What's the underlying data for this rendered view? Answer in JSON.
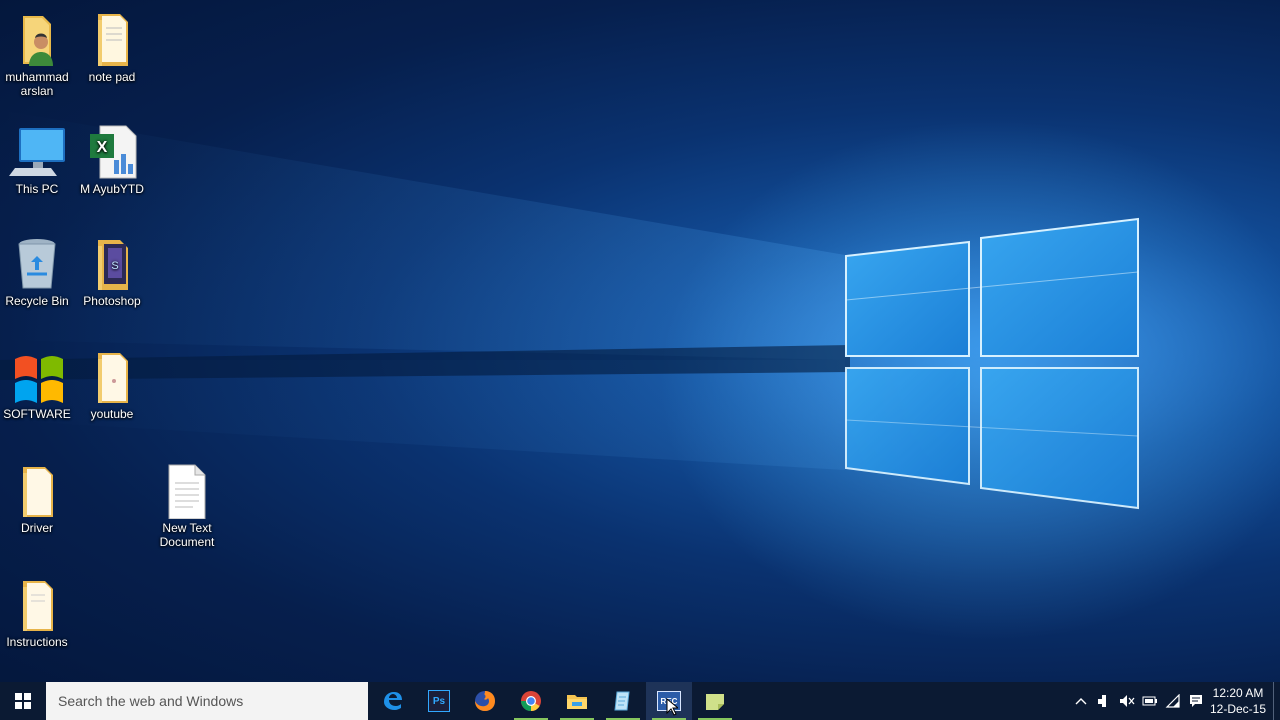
{
  "desktop": {
    "icons": [
      {
        "label": "muhammad arslan",
        "icon": "user-folder-icon"
      },
      {
        "label": "note pad",
        "icon": "folder-icon"
      },
      {
        "label": "This PC",
        "icon": "computer-icon"
      },
      {
        "label": "M AyubYTD",
        "icon": "excel-file-icon"
      },
      {
        "label": "Recycle Bin",
        "icon": "recycle-bin-icon"
      },
      {
        "label": "Photoshop",
        "icon": "folder-icon"
      },
      {
        "label": "SOFTWARE",
        "icon": "windows-logo-icon"
      },
      {
        "label": "youtube",
        "icon": "folder-icon"
      },
      {
        "label": "Driver",
        "icon": "folder-icon"
      },
      {
        "label": "New Text Document",
        "icon": "text-document-icon"
      },
      {
        "label": "Instructions",
        "icon": "folder-icon"
      }
    ]
  },
  "taskbar": {
    "search_placeholder": "Search the web and Windows",
    "apps": [
      {
        "name": "edge-app",
        "icon": "edge-icon",
        "running": false
      },
      {
        "name": "photoshop-app",
        "icon": "photoshop-icon",
        "running": false,
        "text": "Ps"
      },
      {
        "name": "firefox-app",
        "icon": "firefox-icon",
        "running": false
      },
      {
        "name": "chrome-app",
        "icon": "chrome-icon",
        "running": true
      },
      {
        "name": "file-explorer-app",
        "icon": "file-explorer-icon",
        "running": true
      },
      {
        "name": "notepad-app",
        "icon": "notepad-icon",
        "running": true
      },
      {
        "name": "recorder-app",
        "icon": "recorder-icon",
        "running": true,
        "text": "REC"
      },
      {
        "name": "sticky-notes-app",
        "icon": "sticky-notes-icon",
        "running": true
      }
    ],
    "tray": {
      "icons": [
        "chevron-up-icon",
        "network-tray-icon",
        "volume-muted-icon",
        "battery-icon",
        "wifi-icon",
        "action-center-icon"
      ],
      "time": "12:20 AM",
      "date": "12-Dec-15"
    }
  },
  "colors": {
    "taskbar": "#0b1a33",
    "running_indicator": "#86c55e",
    "wallpaper_glow": "#4fb8ff"
  }
}
